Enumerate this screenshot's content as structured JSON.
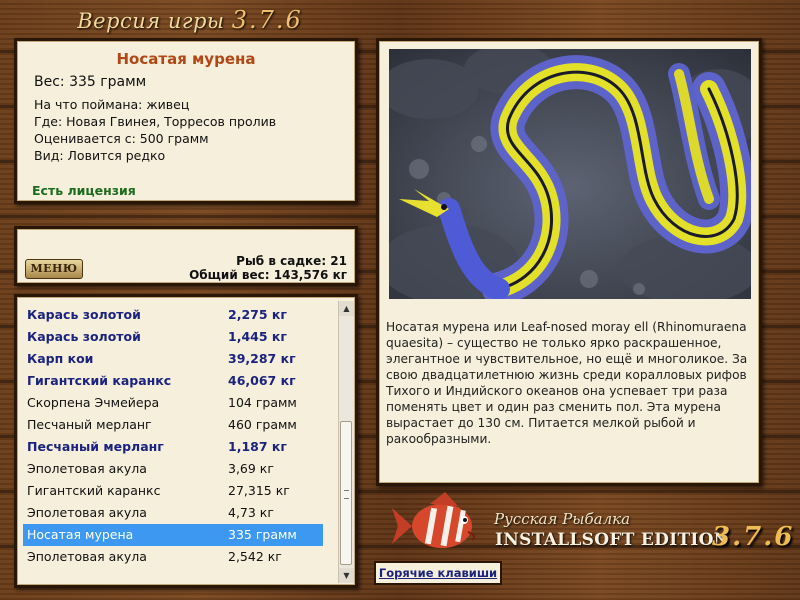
{
  "header": {
    "title_prefix": "Версия игры",
    "title_version": "3.7.6"
  },
  "fish_info": {
    "name": "Носатая мурена",
    "weight_line": "Вес: 335 грамм",
    "bait_line": "На что поймана: живец",
    "location_line": "Где: Новая Гвинея, Торресов пролив",
    "value_line": "Оценивается с: 500 грамм",
    "rarity_line": "Вид: Ловится редко",
    "license": "Есть лицензия"
  },
  "stats": {
    "menu_label": "МЕНЮ",
    "fish_count": "Рыб в садке: 21",
    "total_weight": "Общий вес: 143,576 кг"
  },
  "catch_list": [
    {
      "name": "Карась золотой",
      "weight": "2,275 кг",
      "big": true
    },
    {
      "name": "Карась золотой",
      "weight": "1,445 кг",
      "big": true
    },
    {
      "name": "Карп кои",
      "weight": "39,287 кг",
      "big": true
    },
    {
      "name": "Гигантский каранкс",
      "weight": "46,067 кг",
      "big": true
    },
    {
      "name": "Скорпена Эчмейера",
      "weight": "104 грамм",
      "big": false
    },
    {
      "name": "Песчаный мерланг",
      "weight": "460 грамм",
      "big": false
    },
    {
      "name": "Песчаный мерланг",
      "weight": "1,187 кг",
      "big": true
    },
    {
      "name": "Эполетовая акула",
      "weight": "3,69 кг",
      "big": false
    },
    {
      "name": "Гигантский каранкс",
      "weight": "27,315 кг",
      "big": false
    },
    {
      "name": "Эполетовая акула",
      "weight": "4,73 кг",
      "big": false
    },
    {
      "name": "Носатая мурена",
      "weight": "335 грамм",
      "big": false,
      "selected": true
    },
    {
      "name": "Эполетовая акула",
      "weight": "2,542 кг",
      "big": false
    }
  ],
  "description": "Носатая мурена или Leaf-nosed moray ell (Rhinomuraena quaesita) – существо не только ярко раскрашенное, элегантное и чувствительное, но ещё и многоликое. За свою двадцатилетнюю жизнь среди коралловых рифов Тихого и Индийского океанов она успевает три раза поменять цвет и один раз сменить пол. Эта мурена вырастает до 130 см. Питается мелкой рыбой и ракообразными.",
  "logo": {
    "line1": "Русская Рыбалка",
    "line2": "INSTALLSOFT EDITION",
    "version": "3.7.6"
  },
  "hotkeys_label": "Горячие клавиши",
  "colors": {
    "selection": "#3c98f0",
    "big_fish_text": "#1b237e",
    "license_text": "#1d6b1d",
    "fish_name": "#b14714"
  }
}
